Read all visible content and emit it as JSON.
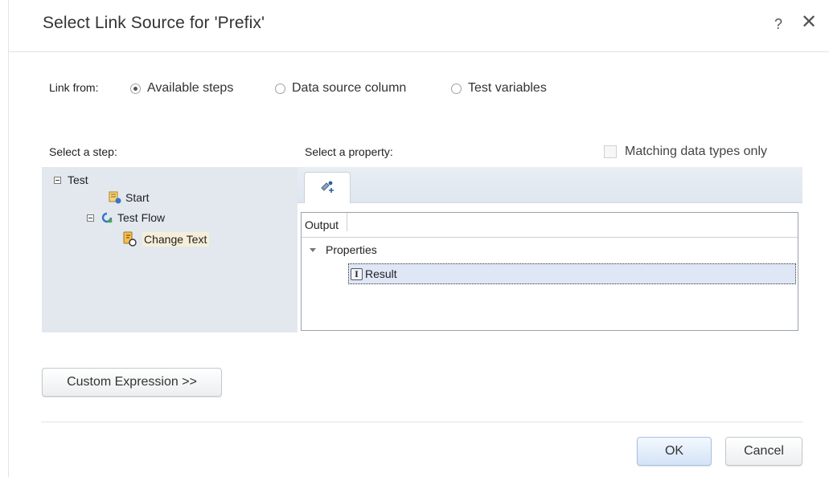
{
  "dialog": {
    "title": "Select Link Source for 'Prefix'",
    "help_label": "?",
    "close_label": "✕"
  },
  "link_from": {
    "label": "Link from:",
    "options": [
      {
        "label": "Available steps",
        "selected": true
      },
      {
        "label": "Data source column",
        "selected": false
      },
      {
        "label": "Test variables",
        "selected": false
      }
    ]
  },
  "steps": {
    "label": "Select a step:",
    "tree": {
      "root": "Test",
      "start": "Start",
      "flow": "Test Flow",
      "change": "Change Text"
    },
    "selected": "Change Text"
  },
  "property": {
    "label": "Select a property:",
    "matching_label": "Matching data types only",
    "matching_checked": false,
    "tab_icon": "output-properties-icon",
    "grid_header": "Output",
    "group": "Properties",
    "item": "Result",
    "item_icon": "text-type-icon",
    "item_icon_glyph": "I"
  },
  "buttons": {
    "custom_expression": "Custom Expression >>",
    "ok": "OK",
    "cancel": "Cancel"
  },
  "colors": {
    "tree_bg": "#e3e8ef",
    "selected_row": "#dfe7f6",
    "selected_step": "#f5eed8",
    "ok_button": "#d3e3f7"
  }
}
